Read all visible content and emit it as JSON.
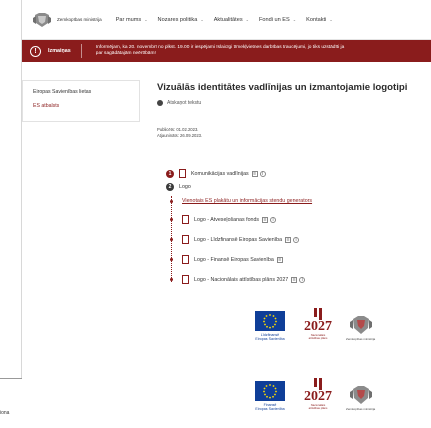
{
  "header": {
    "ministry_name": "Zemkopības ministrija",
    "nav": [
      {
        "label": "Par mums"
      },
      {
        "label": "Nozares politika"
      },
      {
        "label": "Aktualitātes"
      },
      {
        "label": "Fondi un ES"
      },
      {
        "label": "Kontakti"
      }
    ]
  },
  "notice": {
    "label": "Izmaiņas",
    "text_line1": "Informējam, ka 20. novembrī no plkst. 19.00 ir iespējami īslaicīgi tīmekļvietnes darbības traucējumi, jo tiks uzstādīti ja",
    "text_line2": "par sagādātajām neērtībām!"
  },
  "sidebar": {
    "items": [
      {
        "label": "Eiropas Savienības lietas"
      },
      {
        "label": "ES atbalsts"
      }
    ]
  },
  "page": {
    "title": "Vizuālās identitātes vadlīnijas un izmantojamie logotipi",
    "listen_label": "Atskaņot tekstu",
    "published": "Publicēts: 01.02.2023.",
    "updated": "Atjaunināts: 26.09.2023."
  },
  "sections": [
    {
      "number": "1",
      "label": "Komunikācijas vadlīnijas"
    },
    {
      "number": "2",
      "label": "Logo"
    }
  ],
  "logo_items": [
    {
      "label": "Vienotais ES plakātu un informācijas stendu generators",
      "type": "link"
    },
    {
      "label": "Logo - Atveseļošanas fonds",
      "type": "file"
    },
    {
      "label": "Logo - Līdzfinansē Eiropas Savienība",
      "type": "file"
    },
    {
      "label": "Logo - Finansē Eiropas Savienība",
      "type": "file"
    },
    {
      "label": "Logo - Nacionālais attīstības plāns 2027",
      "type": "file"
    }
  ],
  "logos_row1": {
    "eu_label_line1": "Līdzfinansē",
    "eu_label_line2": "Eiropas Savienība",
    "nap_number": "2027",
    "nap_sub_line1": "Nacionālais",
    "nap_sub_line2": "attīstības plāns",
    "ministry_caption": "Zemkopības ministrija"
  },
  "logos_row2": {
    "eu_label_line1": "Finansē",
    "eu_label_line2": "Eiropas Savienība",
    "nap_number": "2027",
    "nap_sub_line1": "Nacionālais",
    "nap_sub_line2": "attīstības plāns",
    "ministry_caption": "Zemkopības ministrija"
  },
  "bottom_fragment": "iona",
  "colors": {
    "accent": "#8a1c1c",
    "eu_blue": "#0f3e98",
    "eu_star": "#ffdd00"
  },
  "icons": [
    "crest-icon",
    "chevron-down-icon",
    "info-icon",
    "speaker-icon",
    "file-icon",
    "doc-icon",
    "circle-info-icon"
  ]
}
